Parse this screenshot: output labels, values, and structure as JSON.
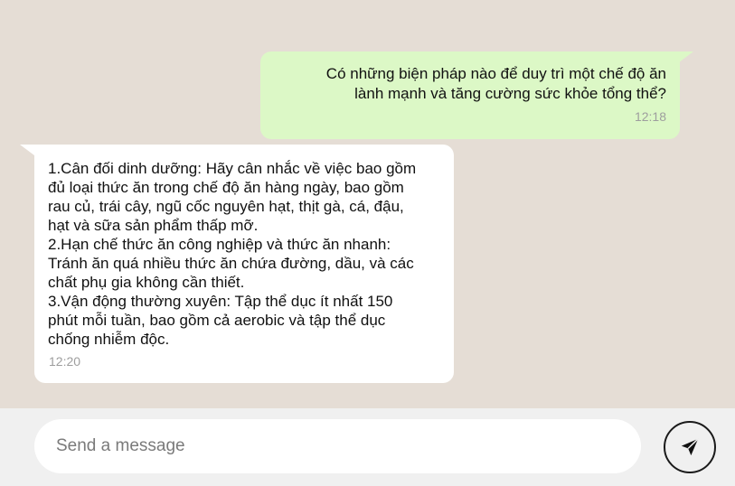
{
  "conversation": {
    "outgoing": {
      "lines": [
        "Có những biện pháp nào để duy trì một chế độ ăn",
        "lành mạnh và tăng cường sức khỏe tổng thể?"
      ],
      "time": "12:18"
    },
    "incoming": {
      "lines": [
        "1.Cân đối dinh dưỡng: Hãy cân nhắc về việc bao gồm",
        "đủ loại thức ăn trong chế độ ăn hàng ngày, bao gồm",
        "rau củ, trái cây, ngũ cốc nguyên hạt, thịt gà, cá, đậu,",
        "hạt và sữa sản phẩm thấp mỡ.",
        "2.Hạn chế thức ăn công nghiệp và thức ăn nhanh:",
        "Tránh ăn quá nhiều thức ăn chứa đường, dầu, và các",
        "chất phụ gia không cần thiết.",
        "3.Vận động thường xuyên: Tập thể dục ít nhất 150",
        "phút mỗi tuần, bao gồm cả aerobic và tập thể dục",
        "chống nhiễm độc."
      ],
      "time": "12:20"
    }
  },
  "composer": {
    "placeholder": "Send a message",
    "value": "",
    "send_icon": "send-icon"
  },
  "colors": {
    "chat_background": "#e5ddd5",
    "outgoing_bubble": "#dcf8c6",
    "incoming_bubble": "#ffffff",
    "composer_background": "#f0f0f0",
    "timestamp": "#9e9e9e"
  }
}
